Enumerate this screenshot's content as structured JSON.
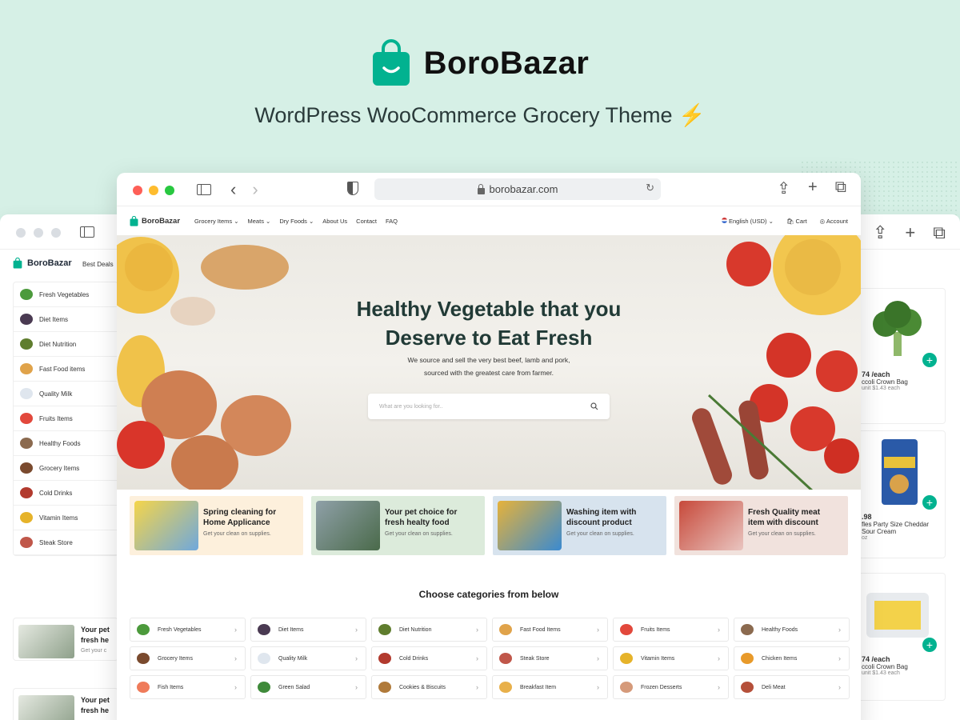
{
  "brand": {
    "name": "BoroBazar",
    "tagline": "WordPress WooCommerce Grocery Theme",
    "tagline_icon": "lightning-bolt-icon"
  },
  "colors": {
    "background": "#d6f0e6",
    "accent": "#02b290",
    "hero_title": "#213a36"
  },
  "back_window": {
    "logo": "BoroBazar",
    "nav_item": "Best Deals",
    "categories": [
      "Fresh Vegetables",
      "Diet Items",
      "Diet Nutrition",
      "Fast Food items",
      "Quality Milk",
      "Fruits Items",
      "Healthy Foods",
      "Grocery Items",
      "Cold Drinks",
      "Vitamin Items",
      "Steak Store"
    ],
    "promos": [
      {
        "title": "Your pet",
        "title2": "fresh he",
        "sub": "Get your c"
      },
      {
        "title": "Your pet",
        "title2": "fresh he",
        "sub": ""
      }
    ],
    "products": [
      {
        "price": "74 /each",
        "name": "ccoli Crown Bag",
        "unit": "unit $1.43 each"
      },
      {
        "price": ".98",
        "name": "fles Party Size Cheddar Sour Cream",
        "unit": "oz"
      },
      {
        "price": "74 /each",
        "name": "ccoli Crown Bag",
        "unit": "unit $1.43 each"
      }
    ]
  },
  "browser": {
    "url": "borobazar.com"
  },
  "site_nav": {
    "logo": "BoroBazar",
    "links": [
      "Grocery Items",
      "Meats",
      "Dry Foods",
      "About Us",
      "Contact",
      "FAQ"
    ],
    "language": "English (USD)",
    "cart": "Cart",
    "account": "Account"
  },
  "hero": {
    "title_line1": "Healthy Vegetable that you",
    "title_line2": "Deserve to Eat Fresh",
    "sub_line1": "We source and sell the very best beef, lamb and pork,",
    "sub_line2": "sourced with the greatest care from farmer.",
    "search_placeholder": "What are you looking for.."
  },
  "promos": [
    {
      "title1": "Spring cleaning for",
      "title2": "Home Applicance",
      "sub": "Get your clean on supplies.",
      "bg": "#fdf0dc"
    },
    {
      "title1": "Your pet choice for",
      "title2": "fresh healty food",
      "sub": "Get your clean on supplies.",
      "bg": "#dcebdb"
    },
    {
      "title1": "Washing item with",
      "title2": "discount product",
      "sub": "Get your clean on supplies.",
      "bg": "#d7e3ee"
    },
    {
      "title1": "Fresh Quality meat",
      "title2": "item with discount",
      "sub": "Get your clean on supplies.",
      "bg": "#f1e2dd"
    }
  ],
  "categories_heading": "Choose categories from below",
  "categories": [
    {
      "label": "Fresh Vegetables",
      "icon": "broccoli-icon",
      "color": "#4c9a3c"
    },
    {
      "label": "Diet Items",
      "icon": "eggplant-icon",
      "color": "#4a3a52"
    },
    {
      "label": "Diet Nutrition",
      "icon": "avocado-icon",
      "color": "#5f7d2e"
    },
    {
      "label": "Fast Food Items",
      "icon": "burger-icon",
      "color": "#e0a34a"
    },
    {
      "label": "Fruits Items",
      "icon": "watermelon-icon",
      "color": "#e2483c"
    },
    {
      "label": "Healthy Foods",
      "icon": "coconut-icon",
      "color": "#8b6a4f"
    },
    {
      "label": "Grocery Items",
      "icon": "grocery-icon",
      "color": "#7a4a2e"
    },
    {
      "label": "Quality Milk",
      "icon": "milk-icon",
      "color": "#dfe6ee"
    },
    {
      "label": "Cold Drinks",
      "icon": "drink-icon",
      "color": "#b23a2e"
    },
    {
      "label": "Steak Store",
      "icon": "steak-icon",
      "color": "#c0574a"
    },
    {
      "label": "Vitamin Items",
      "icon": "pineapple-icon",
      "color": "#e6b32a"
    },
    {
      "label": "Chicken Items",
      "icon": "chicken-icon",
      "color": "#e89a2a"
    },
    {
      "label": "Fish Items",
      "icon": "fish-icon",
      "color": "#ef7b5a"
    },
    {
      "label": "Green Salad",
      "icon": "salad-icon",
      "color": "#3f8a3a"
    },
    {
      "label": "Cookies & Biscuits",
      "icon": "cookie-icon",
      "color": "#b07a3a"
    },
    {
      "label": "Breakfast Item",
      "icon": "bread-icon",
      "color": "#e8b04a"
    },
    {
      "label": "Frozen Desserts",
      "icon": "icecream-icon",
      "color": "#d59a7a"
    },
    {
      "label": "Deli Meat",
      "icon": "sausage-icon",
      "color": "#b5503a"
    }
  ]
}
